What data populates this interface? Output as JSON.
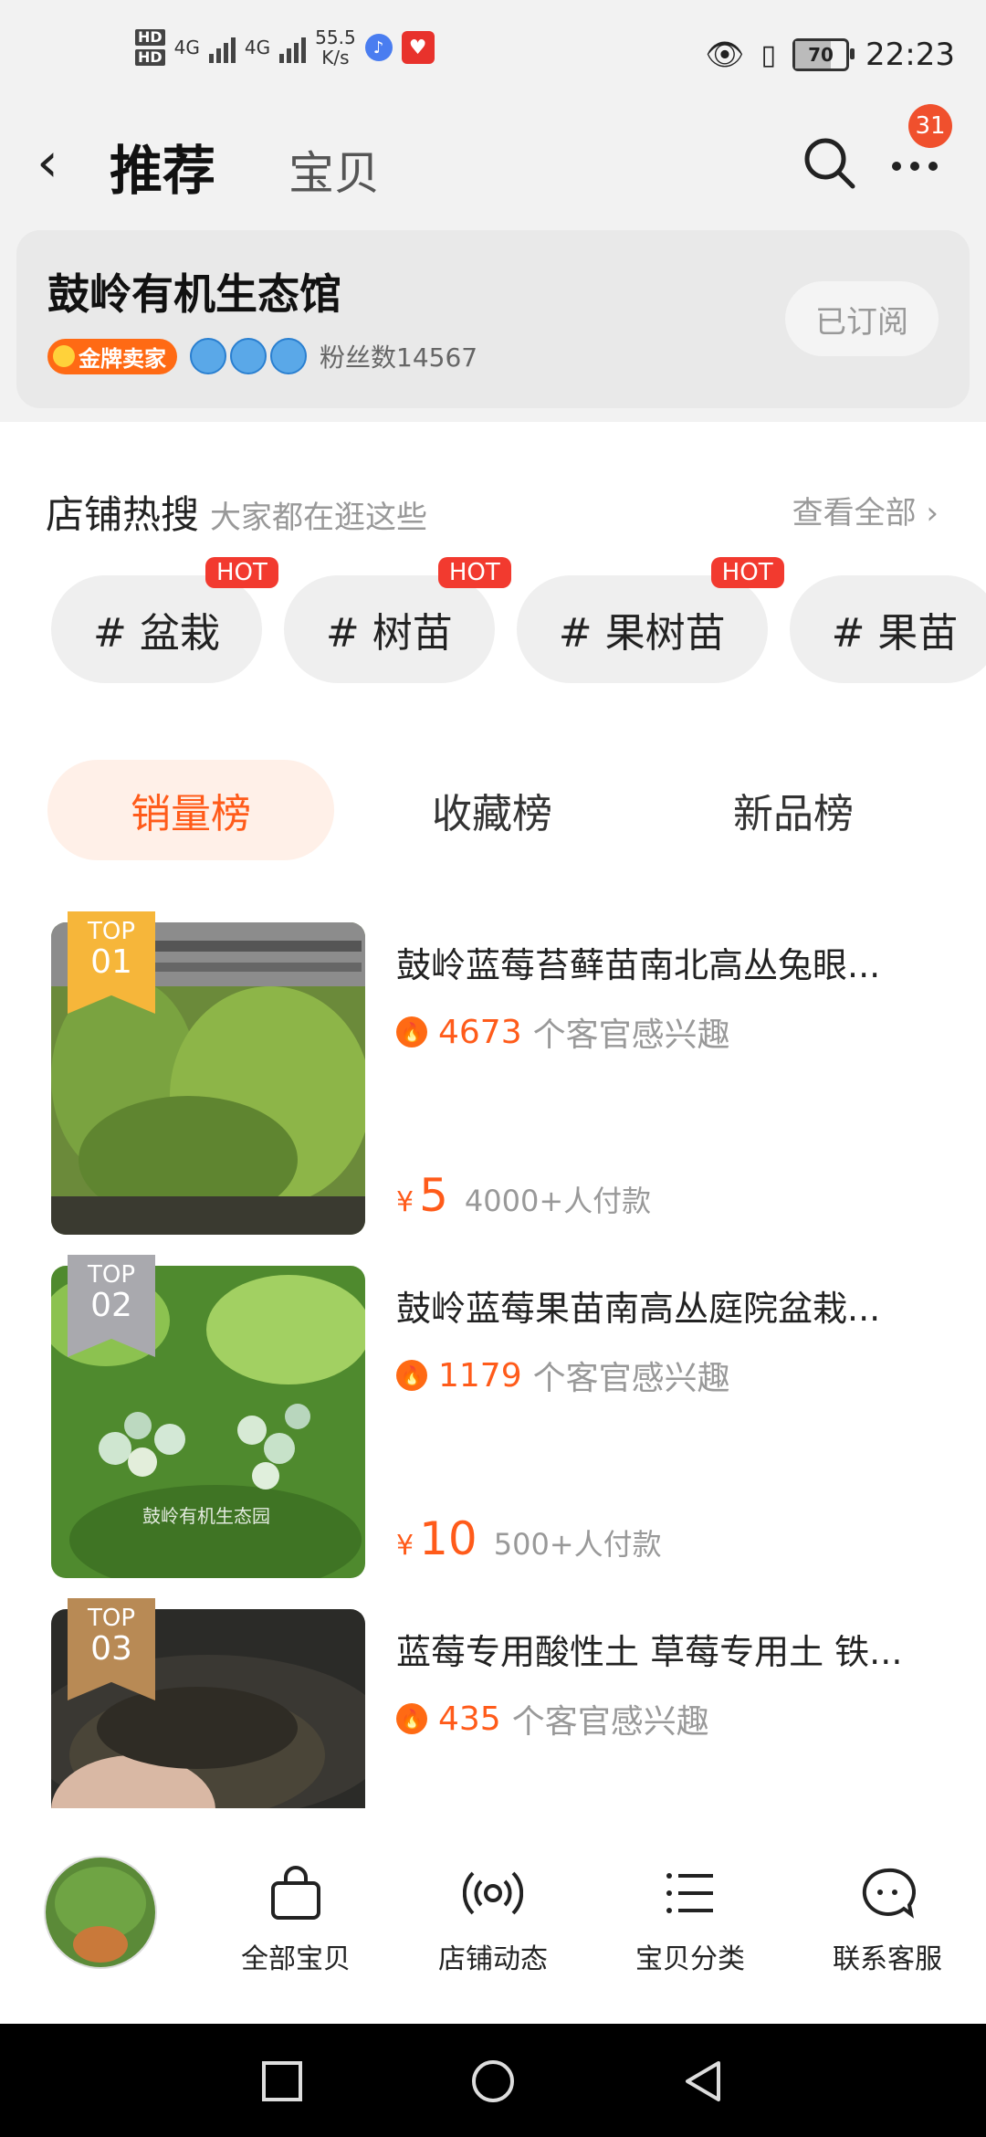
{
  "status_bar": {
    "network_1": "4G",
    "network_2": "4G",
    "speed_value": "55.5",
    "speed_unit": "K/s",
    "battery": "70",
    "time": "22:23"
  },
  "header": {
    "active_tab": "推荐",
    "other_tab": "宝贝",
    "notification_count": "31"
  },
  "shop": {
    "name": "鼓岭有机生态馆",
    "gold_badge": "金牌卖家",
    "fans": "粉丝数14567",
    "subscribe_label": "已订阅"
  },
  "hot_search": {
    "title": "店铺热搜",
    "subtitle": "大家都在逛这些",
    "view_all": "查看全部 ›",
    "chips": [
      {
        "label": "# 盆栽",
        "hot": "HOT"
      },
      {
        "label": "# 树苗",
        "hot": "HOT"
      },
      {
        "label": "# 果树苗",
        "hot": "HOT"
      },
      {
        "label": "# 果苗",
        "hot": ""
      }
    ]
  },
  "rank_tabs": [
    "销量榜",
    "收藏榜",
    "新品榜"
  ],
  "items": [
    {
      "top_label": "TOP",
      "rank": "01",
      "title": "鼓岭蓝莓苔藓苗南北高丛兔眼...",
      "interest_count": "4673",
      "interest_text": "个客官感兴趣",
      "price_symbol": "¥",
      "price": "5",
      "paid": "4000+人付款"
    },
    {
      "top_label": "TOP",
      "rank": "02",
      "title": "鼓岭蓝莓果苗南高丛庭院盆栽...",
      "interest_count": "1179",
      "interest_text": "个客官感兴趣",
      "price_symbol": "¥",
      "price": "10",
      "paid": "500+人付款",
      "watermark": "鼓岭有机生态园"
    },
    {
      "top_label": "TOP",
      "rank": "03",
      "title": "蓝莓专用酸性土 草莓专用土 铁...",
      "interest_count": "435",
      "interest_text": "个客官感兴趣"
    }
  ],
  "bottom_nav": [
    {
      "label": "全部宝贝",
      "icon": "shopping-bag-icon"
    },
    {
      "label": "店铺动态",
      "icon": "broadcast-icon"
    },
    {
      "label": "宝贝分类",
      "icon": "list-icon"
    },
    {
      "label": "联系客服",
      "icon": "chat-face-icon"
    }
  ],
  "colors": {
    "accent": "#ff5b1a",
    "hot_tag": "#f23a2f",
    "top1": "#f6b63a",
    "top2": "#a9a9ae",
    "top3": "#b88a55"
  }
}
